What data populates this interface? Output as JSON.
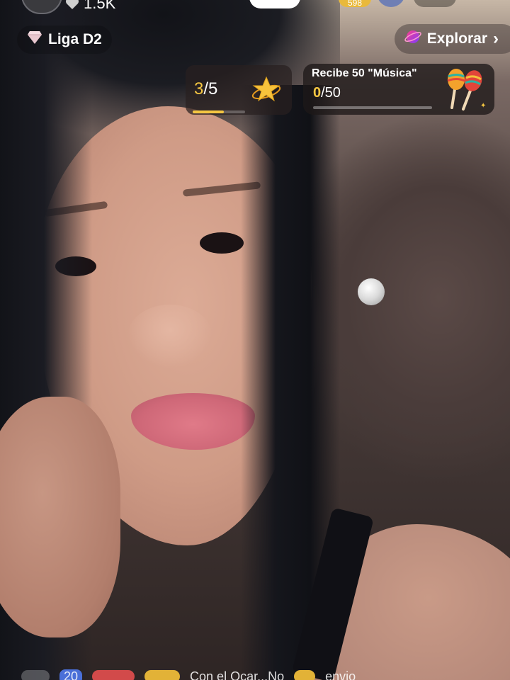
{
  "top_bar": {
    "likes_count": "1.5K",
    "gold_badge_text": "598"
  },
  "league": {
    "icon": "diamond-icon",
    "label": "Liga D2"
  },
  "explore": {
    "icon": "planet-icon",
    "label": "Explorar",
    "chevron": "›"
  },
  "progress": {
    "current": "3",
    "total": "/5",
    "fraction": 0.6,
    "icon": "star-icon"
  },
  "quest": {
    "title": "Recibe 50 \"Música\"",
    "current": "0",
    "total": "/50",
    "fraction": 0,
    "icon": "maracas-icon"
  },
  "bottom": {
    "badge_text": "20",
    "comment_text": "Con el Ocar...No",
    "trailing_text": "envio"
  },
  "colors": {
    "accent": "#f4c642",
    "card_bg": "#281f1f"
  }
}
